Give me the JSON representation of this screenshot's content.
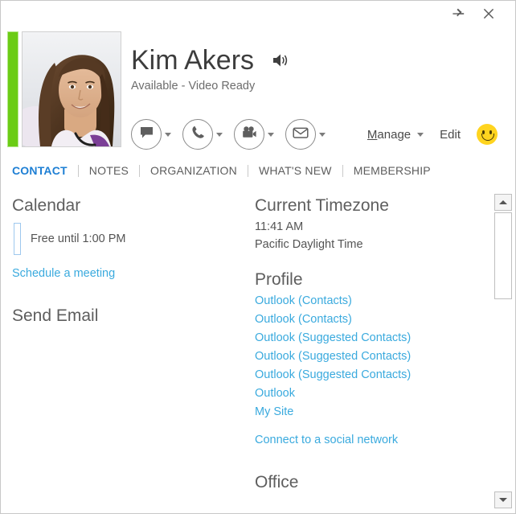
{
  "window": {
    "pin_icon": "pin-icon",
    "close_icon": "close-icon"
  },
  "contact": {
    "name": "Kim Akers",
    "presence_status": "Available - Video Ready",
    "presence_color": "#6bcc15",
    "speaker_icon": "speaker-icon",
    "avatar_alt": "Kim Akers photo"
  },
  "actions": {
    "items": [
      {
        "icon": "chat-icon",
        "label": "Send an IM"
      },
      {
        "icon": "phone-icon",
        "label": "Call"
      },
      {
        "icon": "video-icon",
        "label": "Start a video call"
      },
      {
        "icon": "email-icon",
        "label": "Send an email message"
      }
    ],
    "manage_label": "Manage",
    "manage_accel": "M",
    "manage_rest": "anage",
    "edit_label": "Edit",
    "emoticon_icon": "smiley-icon"
  },
  "tabs": [
    {
      "label": "CONTACT",
      "active": true
    },
    {
      "label": "NOTES",
      "active": false
    },
    {
      "label": "ORGANIZATION",
      "active": false
    },
    {
      "label": "WHAT'S NEW",
      "active": false
    },
    {
      "label": "MEMBERSHIP",
      "active": false
    }
  ],
  "left_column": {
    "calendar_heading": "Calendar",
    "calendar_status": "Free until 1:00 PM",
    "schedule_link": "Schedule a meeting",
    "send_email_heading": "Send Email"
  },
  "right_column": {
    "timezone_heading": "Current Timezone",
    "timezone_time": "11:41 AM",
    "timezone_name": "Pacific Daylight Time",
    "profile_heading": "Profile",
    "profile_links": [
      "Outlook (Contacts)",
      "Outlook (Contacts)",
      "Outlook (Suggested Contacts)",
      "Outlook (Suggested Contacts)",
      "Outlook (Suggested Contacts)",
      "Outlook",
      "My Site"
    ],
    "social_link": "Connect to a social network",
    "office_heading": "Office"
  },
  "scrollbar": {
    "up_icon": "scroll-up-arrow-icon",
    "down_icon": "scroll-down-arrow-icon"
  },
  "colors": {
    "link": "#3aaade",
    "active_tab": "#1e7fd4",
    "presence_green": "#6bcc15",
    "heading": "#5e5e5e",
    "emoticon_yellow": "#ffd41f"
  }
}
